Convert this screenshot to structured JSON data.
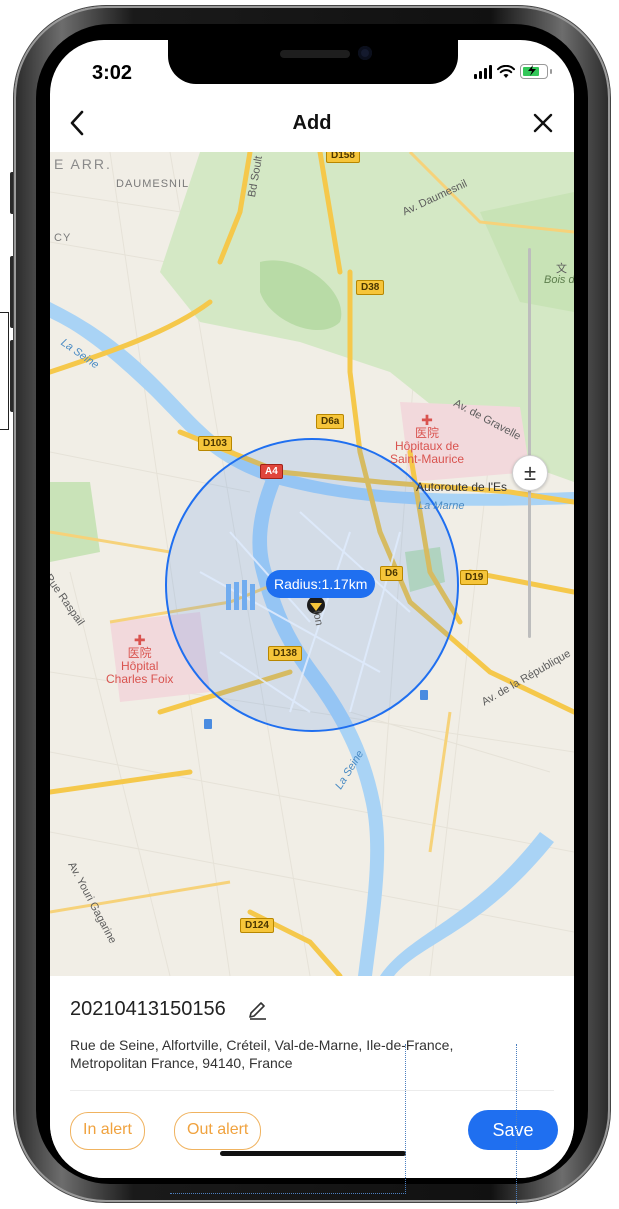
{
  "status_bar": {
    "time": "3:02"
  },
  "nav": {
    "title": "Add",
    "back_icon": "chevron-left-icon",
    "close_icon": "close-icon"
  },
  "map": {
    "radius_label": "Radius:1.17km",
    "labels": {
      "arr": "E ARR.",
      "daumesnil": "DAUMESNIL",
      "cy": "CY",
      "bd_soult": "Bd Soult",
      "av_daumesnil": "Av. Daumesnil",
      "bois": "Bois d",
      "la_seine_top": "La Seine",
      "av_gravelle": "Av. de Gravelle",
      "autoroute": "Autoroute de l'Es",
      "la_marne": "La Marne",
      "rue_raspail": "Rue Raspail",
      "av_republique": "Av. de la République",
      "la_seine_bottom": "La Seine",
      "av_youri": "Av. Youri Gagarine",
      "hopitaux_cn": "医院",
      "hopitaux_name_1": "Hôpitaux de",
      "hopitaux_name_2": "Saint-Maurice",
      "charles_cn": "医院",
      "charles_name_1": "Hôpital",
      "charles_name_2": "Charles Foix",
      "wen": "文",
      "fon": "fon"
    },
    "road_badges": {
      "d158": "D158",
      "d38": "D38",
      "d6a": "D6a",
      "d103": "D103",
      "a4": "A4",
      "d6": "D6",
      "d19": "D19",
      "d138": "D138",
      "d124": "D124"
    },
    "colors": {
      "water": "#a9d3f5",
      "park": "#cfe6c0",
      "road_major": "#f5c84b",
      "circle": "#1f6ff0"
    }
  },
  "fence": {
    "name": "20210413150156",
    "address": "Rue de Seine, Alfortville, Créteil, Val-de-Marne, Ile-de-France, Metropolitan France, 94140, France"
  },
  "buttons": {
    "in_alert": "In alert",
    "out_alert": "Out alert",
    "save": "Save"
  }
}
